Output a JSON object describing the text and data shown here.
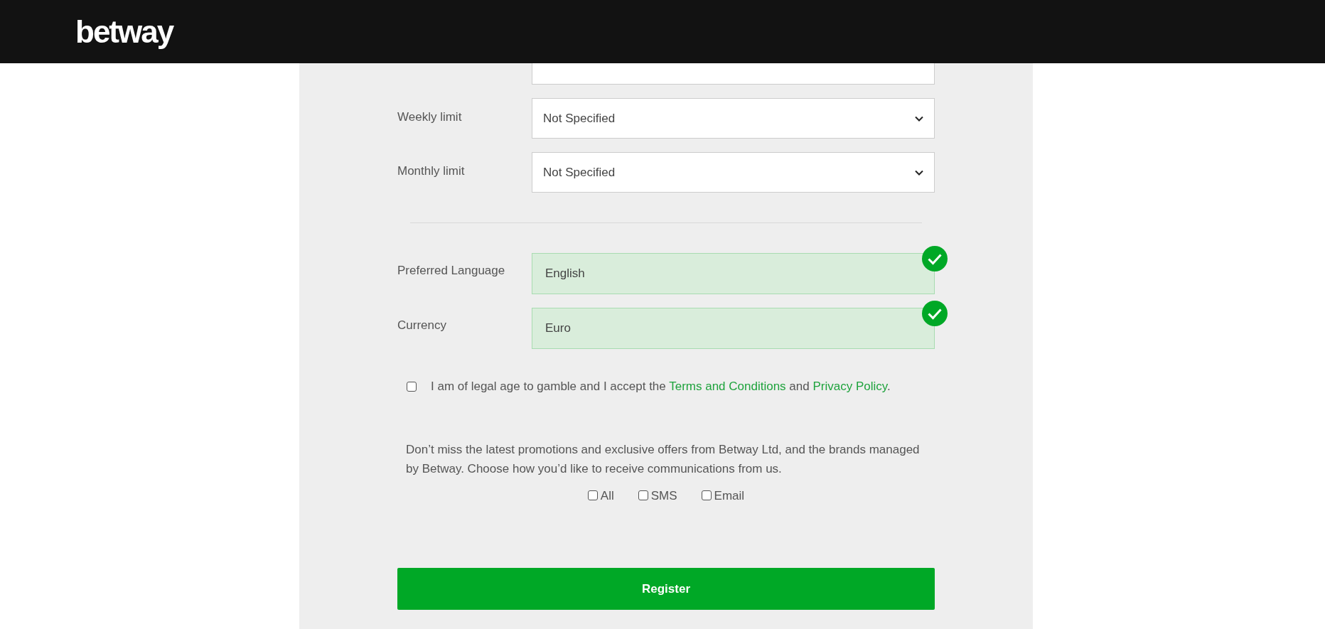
{
  "header": {
    "logo": "betway"
  },
  "limits": [
    {
      "label": "Weekly limit",
      "value": "Not Specified"
    },
    {
      "label": "Monthly limit",
      "value": "Not Specified"
    }
  ],
  "fields": [
    {
      "label": "Preferred Language",
      "value": "English",
      "valid": true
    },
    {
      "label": "Currency",
      "value": "Euro",
      "valid": true
    }
  ],
  "terms": {
    "checked": false,
    "text_before": "I am of legal age to gamble and I accept the",
    "link_1": "Terms and Conditions",
    "text_middle": "and",
    "link_2": "Privacy Policy",
    "text_after": "."
  },
  "marketing": {
    "text": "Don’t miss the latest promotions and exclusive offers from Betway Ltd, and the brands managed by Betway. Choose how you’d like to receive communications from us.",
    "options": [
      {
        "label": "All",
        "checked": false
      },
      {
        "label": "SMS",
        "checked": false
      },
      {
        "label": "Email",
        "checked": false
      }
    ]
  },
  "register_button": "Register"
}
